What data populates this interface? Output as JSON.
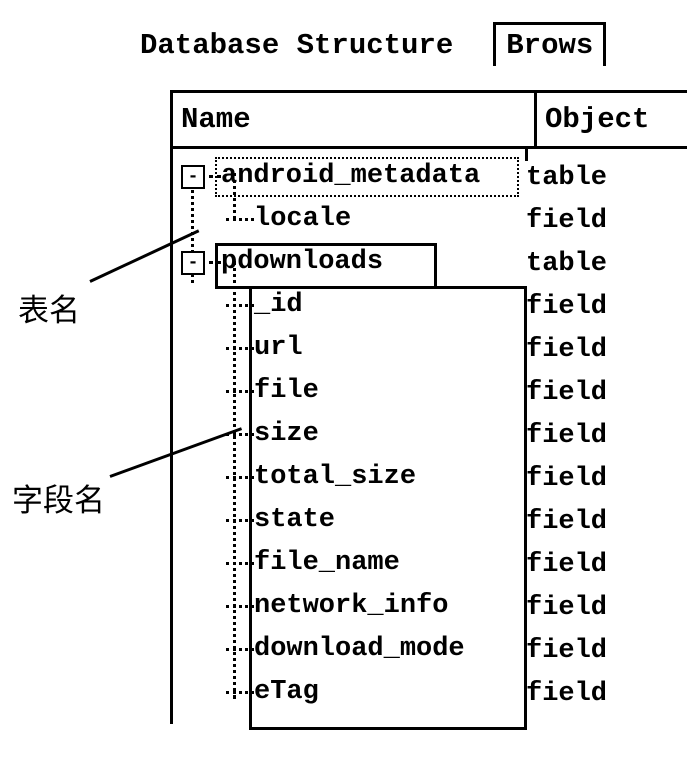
{
  "tabs": {
    "structure": "Database Structure",
    "browse": "Brows"
  },
  "columns": {
    "name": "Name",
    "object": "Object"
  },
  "tree": [
    {
      "label": "android_metadata",
      "object": "table",
      "level": 0,
      "expander": "-"
    },
    {
      "label": "locale",
      "object": "field",
      "level": 1
    },
    {
      "label": "pdownloads",
      "object": "table",
      "level": 0,
      "expander": "-"
    },
    {
      "label": "_id",
      "object": "field",
      "level": 1
    },
    {
      "label": "url",
      "object": "field",
      "level": 1
    },
    {
      "label": "file",
      "object": "field",
      "level": 1
    },
    {
      "label": "size",
      "object": "field",
      "level": 1
    },
    {
      "label": "total_size",
      "object": "field",
      "level": 1
    },
    {
      "label": "state",
      "object": "field",
      "level": 1
    },
    {
      "label": "file_name",
      "object": "field",
      "level": 1
    },
    {
      "label": "network_info",
      "object": "field",
      "level": 1
    },
    {
      "label": "download_mode",
      "object": "field",
      "level": 1
    },
    {
      "label": "eTag",
      "object": "field",
      "level": 1
    }
  ],
  "annotations": {
    "table_name": "表名",
    "field_name": "字段名"
  }
}
